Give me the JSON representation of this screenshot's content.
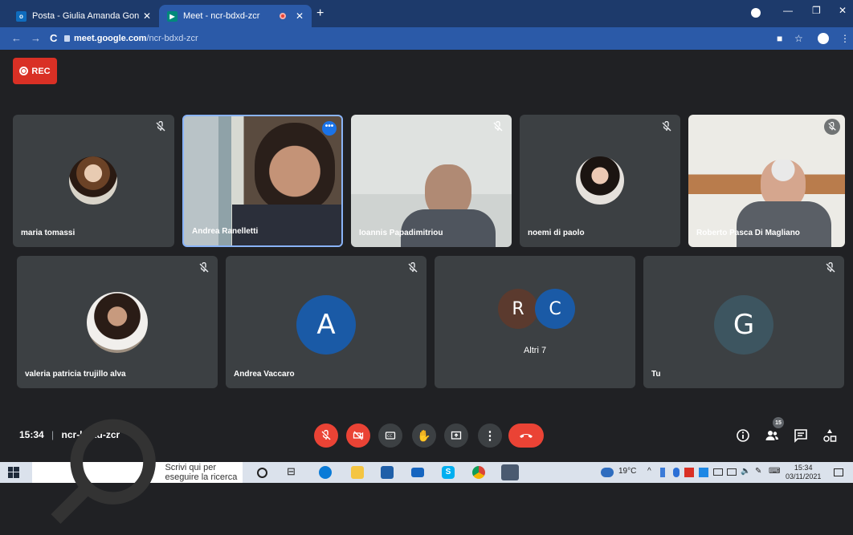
{
  "browser": {
    "tabs": [
      {
        "label": "Posta - Giulia Amanda Gonnella",
        "favicon": "outlook-icon",
        "active": false
      },
      {
        "label": "Meet - ncr-bdxd-zcr",
        "favicon": "meet-icon",
        "active": true
      }
    ],
    "address": {
      "host": "meet.google.com",
      "path": "/ncr-bdxd-zcr"
    }
  },
  "meet": {
    "rec_label": "REC",
    "participants": [
      {
        "name": "maria tomassi",
        "type": "photo",
        "muted": true
      },
      {
        "name": "Andrea Ranelletti",
        "type": "video",
        "muted": false,
        "speaking": true
      },
      {
        "name": "Ioannis Papadimitriou",
        "type": "video",
        "muted": true
      },
      {
        "name": "noemi di paolo",
        "type": "photo",
        "muted": true
      },
      {
        "name": "Roberto Pasca Di Magliano",
        "type": "video",
        "muted": true
      },
      {
        "name": "valeria patricia trujillo alva",
        "type": "photo",
        "muted": true
      },
      {
        "name": "Andrea Vaccaro",
        "type": "letter",
        "letter": "A",
        "color": "#1a5aa6",
        "muted": true
      },
      {
        "name": "Altri 7",
        "type": "group",
        "letters": [
          "R",
          "C"
        ],
        "colors": [
          "#5b3a2e",
          "#1a5aa6"
        ]
      },
      {
        "name": "Tu",
        "type": "letter",
        "letter": "G",
        "color": "#3d5560",
        "muted": true
      }
    ],
    "time": "15:34",
    "meeting_code": "ncr-bdxd-zcr",
    "participant_count": "15"
  },
  "taskbar": {
    "search_placeholder": "Scrivi qui per eseguire la ricerca",
    "weather": "19°C",
    "clock_time": "15:34",
    "clock_date": "03/11/2021"
  }
}
